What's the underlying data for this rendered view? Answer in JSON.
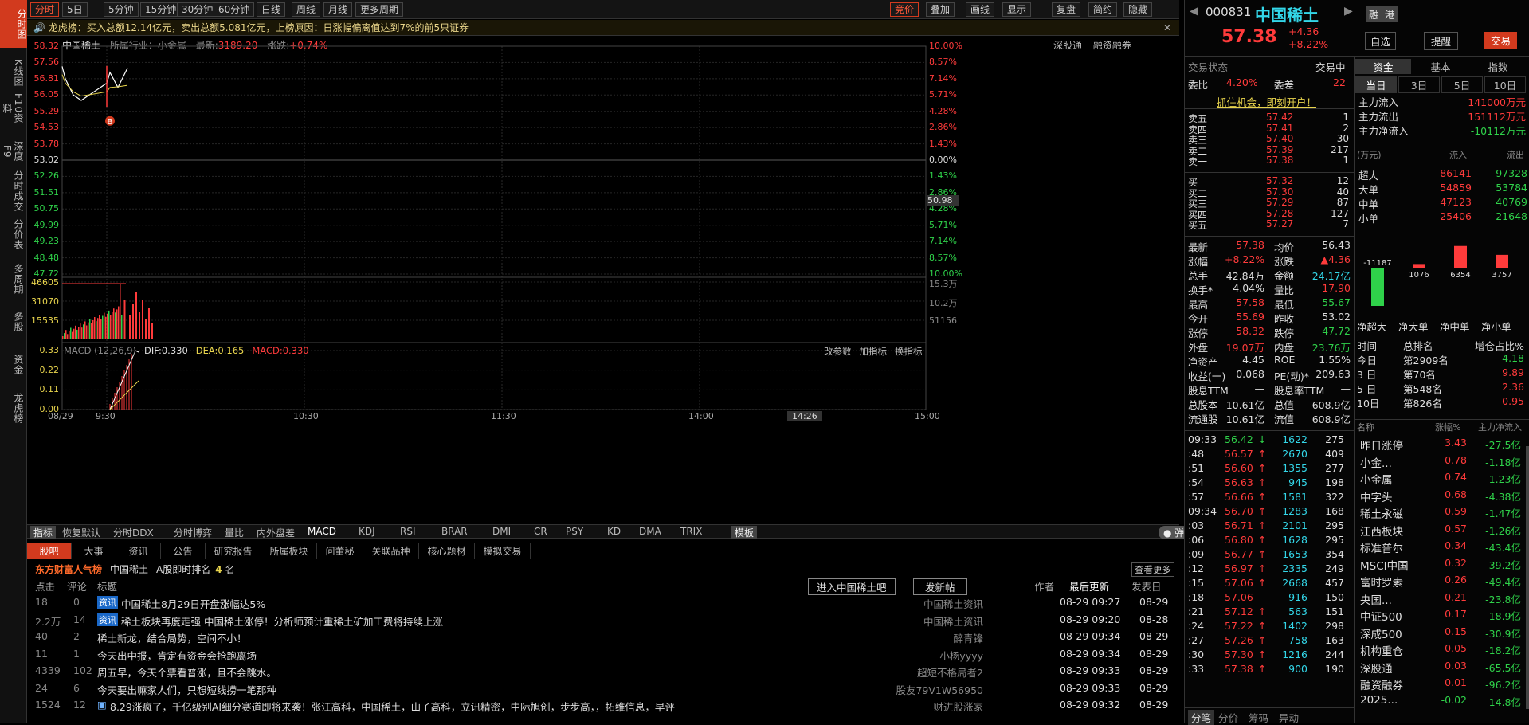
{
  "left_tabs": [
    "分时图",
    "K线图",
    "F10资料",
    "深度F9",
    "分时成交",
    "分价表",
    "多周期",
    "多股",
    "资金",
    "龙虎榜"
  ],
  "toolbar": {
    "items": [
      "分时",
      "5日",
      "5分钟",
      "15分钟",
      "30分钟",
      "60分钟",
      "日线",
      "周线",
      "月线",
      "更多周期"
    ],
    "right_items": [
      "竞价",
      "叠加",
      "画线",
      "显示",
      "复盘",
      "简约",
      "隐藏"
    ]
  },
  "lhb": {
    "text": "龙虎榜：买入总额12.14亿元，卖出总额5.081亿元，上榜原因：日涨幅偏离值达到7%的前5只证券"
  },
  "chart_header": {
    "name": "中国稀土",
    "industry": "所属行业：小金属",
    "latest_label": "最新:",
    "latest": "3189.20",
    "chg_label": "涨跌:",
    "chg": "+0.74%",
    "btn1": "深股通",
    "btn2": "融资融券"
  },
  "price_axis_left": [
    "58.32",
    "57.56",
    "56.81",
    "56.05",
    "55.29",
    "54.53",
    "53.78",
    "53.02",
    "52.26",
    "51.51",
    "50.75",
    "49.99",
    "49.23",
    "48.48",
    "47.72"
  ],
  "price_axis_right": [
    "10.00%",
    "8.57%",
    "7.14%",
    "5.71%",
    "4.28%",
    "2.86%",
    "1.43%",
    "0.00%",
    "1.43%",
    "2.86%",
    "4.28%",
    "5.71%",
    "7.14%",
    "8.57%",
    "10.00%"
  ],
  "mid_marker": "50.98",
  "vol_axis_left": [
    "46605",
    "31070",
    "15535"
  ],
  "vol_axis_right": [
    "15.3万",
    "10.2万",
    "51156"
  ],
  "macd": {
    "label": "MACD (12,26,9)",
    "dif": "DIF:0.330",
    "dea": "DEA:0.165",
    "macd": "MACD:0.330",
    "btns": [
      "改参数",
      "加指标",
      "换指标"
    ],
    "axis": [
      "0.33",
      "0.22",
      "0.11",
      "0.00"
    ]
  },
  "time_axis": [
    "08/29",
    "9:30",
    "10:30",
    "11:30",
    "14:00",
    "15:00"
  ],
  "time_marker": "14:26",
  "chart_data": {
    "type": "line",
    "title": "中国稀土",
    "x": [
      "9:30",
      "9:31",
      "9:32",
      "9:33",
      "9:34",
      "9:35",
      "9:36",
      "9:37"
    ],
    "price": [
      57.38,
      56.8,
      56.05,
      55.8,
      56.6,
      57.1,
      56.4,
      57.3
    ],
    "avg": [
      57.0,
      56.6,
      56.2,
      56.0,
      56.2,
      56.4,
      56.43,
      56.5
    ],
    "ylim": [
      47.72,
      58.32
    ],
    "prev_close": 53.02
  },
  "ind_tabs": [
    "指标",
    "恢复默认",
    "分时DDX",
    "分时博弈",
    "量比",
    "内外盘差",
    "MACD",
    "KDJ",
    "RSI",
    "BRAR",
    "DMI",
    "CR",
    "PSY",
    "KD",
    "DMA",
    "TRIX",
    "模板"
  ],
  "news": {
    "tabs": [
      "股吧",
      "大事",
      "资讯",
      "公告",
      "研究报告",
      "所属板块",
      "问董秘",
      "关联品种",
      "核心题材",
      "模拟交易"
    ],
    "rank": {
      "brand": "东方财富人气榜",
      "stock": "中国稀土",
      "label": "A股即时排名",
      "num": "4",
      "unit": "名",
      "more": "查看更多"
    },
    "cols": [
      "点击",
      "评论",
      "标题",
      "作者",
      "最后更新",
      "发表日"
    ],
    "btn_enter": "进入中国稀土吧",
    "btn_post": "发新帖",
    "rows": [
      {
        "clicks": "18",
        "comments": "0",
        "tag": "资讯",
        "title": "中国稀土8月29日开盘涨幅达5%",
        "author": "中国稀土资讯",
        "updated": "08-29 09:27",
        "date": "08-29"
      },
      {
        "clicks": "2.2万",
        "comments": "14",
        "tag": "资讯",
        "title": "稀土板块再度走强 中国稀土涨停！分析师预计重稀土矿加工费将持续上涨",
        "author": "中国稀土资讯",
        "updated": "08-29 09:20",
        "date": "08-28"
      },
      {
        "clicks": "40",
        "comments": "2",
        "tag": "",
        "title": "稀土新龙，结合局势，空间不小！",
        "author": "醉青锋",
        "updated": "08-29 09:34",
        "date": "08-29"
      },
      {
        "clicks": "11",
        "comments": "1",
        "tag": "",
        "title": "今天出中报，肯定有资金会抢跑离场",
        "author": "小杨yyyy",
        "updated": "08-29 09:34",
        "date": "08-29"
      },
      {
        "clicks": "4339",
        "comments": "102",
        "tag": "",
        "title": "周五早，今天个票看普涨，且不会跳水。",
        "author": "超短不格局者2",
        "updated": "08-29 09:33",
        "date": "08-29"
      },
      {
        "clicks": "24",
        "comments": "6",
        "tag": "",
        "title": "今天要出嘛家人们，只想短线捞一笔那种",
        "author": "股友79V1W56950",
        "updated": "08-29 09:33",
        "date": "08-29"
      },
      {
        "clicks": "1524",
        "comments": "12",
        "tag": "",
        "title": "8.29涨疯了，千亿级别AI细分赛道即将来袭！张江高科，中国稀土，山子高科，立讯精密，中际旭创，步步高，，拓维信息，早评",
        "author": "财进股涨家",
        "updated": "08-29 09:32",
        "date": "08-29"
      }
    ]
  },
  "quote": {
    "code": "000831",
    "name": "中国稀土",
    "price": "57.38",
    "chg": "+4.36",
    "pct": "+8.22%",
    "b1": "融",
    "b2": "港",
    "sel": "自选",
    "remind": "提醒",
    "trade": "交易",
    "status_label": "交易状态",
    "status": "交易中",
    "wb_label": "委比",
    "wb": "4.20%",
    "wc_label": "委差",
    "wc": "22",
    "promo": "抓住机会，即刻开户！",
    "sell": [
      [
        "卖五",
        "57.42",
        "1"
      ],
      [
        "卖四",
        "57.41",
        "2"
      ],
      [
        "卖三",
        "57.40",
        "30"
      ],
      [
        "卖二",
        "57.39",
        "217"
      ],
      [
        "卖一",
        "57.38",
        "1"
      ]
    ],
    "buy": [
      [
        "买一",
        "57.32",
        "12"
      ],
      [
        "买二",
        "57.30",
        "40"
      ],
      [
        "买三",
        "57.29",
        "87"
      ],
      [
        "买四",
        "57.28",
        "127"
      ],
      [
        "买五",
        "57.27",
        "7"
      ]
    ],
    "stats": [
      [
        "最新",
        "57.38",
        "均价",
        "56.43"
      ],
      [
        "涨幅",
        "+8.22%",
        "涨跌",
        "▲4.36"
      ],
      [
        "总手",
        "42.84万",
        "金额",
        "24.17亿"
      ],
      [
        "换手*",
        "4.04%",
        "量比",
        "17.90"
      ],
      [
        "最高",
        "57.58",
        "最低",
        "55.67"
      ],
      [
        "今开",
        "55.69",
        "昨收",
        "53.02"
      ],
      [
        "涨停",
        "58.32",
        "跌停",
        "47.72"
      ],
      [
        "外盘",
        "19.07万",
        "内盘",
        "23.76万"
      ],
      [
        "净资产",
        "4.45",
        "ROE",
        "1.55%"
      ],
      [
        "收益(一)",
        "0.068",
        "PE(动)*",
        "209.63"
      ],
      [
        "股息TTM",
        "—",
        "股息率TTM",
        "—"
      ],
      [
        "总股本",
        "10.61亿",
        "总值",
        "608.9亿"
      ],
      [
        "流通股",
        "10.61亿",
        "流值",
        "608.9亿"
      ]
    ]
  },
  "ticks": [
    {
      "t": "09:33",
      "p": "56.42",
      "v": "1622",
      "n": "275",
      "d": "down"
    },
    {
      "t": ":48",
      "p": "56.57",
      "v": "2670",
      "n": "409",
      "d": "up"
    },
    {
      "t": ":51",
      "p": "56.60",
      "v": "1355",
      "n": "277",
      "d": "up"
    },
    {
      "t": ":54",
      "p": "56.63",
      "v": "945",
      "n": "198",
      "d": "up"
    },
    {
      "t": ":57",
      "p": "56.66",
      "v": "1581",
      "n": "322",
      "d": "up"
    },
    {
      "t": "09:34",
      "p": "56.70",
      "v": "1283",
      "n": "168",
      "d": "up"
    },
    {
      "t": ":03",
      "p": "56.71",
      "v": "2101",
      "n": "295",
      "d": "up"
    },
    {
      "t": ":06",
      "p": "56.80",
      "v": "1628",
      "n": "295",
      "d": "up"
    },
    {
      "t": ":09",
      "p": "56.77",
      "v": "1653",
      "n": "354",
      "d": "up"
    },
    {
      "t": ":12",
      "p": "56.97",
      "v": "2335",
      "n": "249",
      "d": "up"
    },
    {
      "t": ":15",
      "p": "57.06",
      "v": "2668",
      "n": "457",
      "d": "up"
    },
    {
      "t": ":18",
      "p": "57.06",
      "v": "916",
      "n": "150",
      "d": ""
    },
    {
      "t": ":21",
      "p": "57.12",
      "v": "563",
      "n": "151",
      "d": "up"
    },
    {
      "t": ":24",
      "p": "57.22",
      "v": "1402",
      "n": "298",
      "d": "up"
    },
    {
      "t": ":27",
      "p": "57.26",
      "v": "758",
      "n": "163",
      "d": "up"
    },
    {
      "t": ":30",
      "p": "57.30",
      "v": "1216",
      "n": "244",
      "d": "up"
    },
    {
      "t": ":33",
      "p": "57.38",
      "v": "900",
      "n": "190",
      "d": "up"
    }
  ],
  "bottom_tabs": [
    "分笔",
    "分价",
    "筹码",
    "异动"
  ],
  "fund": {
    "tabs": [
      "资金",
      "基本",
      "指数"
    ],
    "sub": [
      "当日",
      "3日",
      "5日",
      "10日"
    ],
    "main": [
      [
        "主力流入",
        "141000万元"
      ],
      [
        "主力流出",
        "151112万元"
      ],
      [
        "主力净流入",
        "-10112万元"
      ]
    ],
    "unit": "(万元)",
    "in": "流入",
    "out": "流出",
    "rows": [
      [
        "超大",
        "86141",
        "97328"
      ],
      [
        "大单",
        "54859",
        "53784"
      ],
      [
        "中单",
        "47123",
        "40769"
      ],
      [
        "小单",
        "25406",
        "21648"
      ]
    ],
    "bars": [
      {
        "label": "净超大",
        "value": -11187
      },
      {
        "label": "净大单",
        "value": 1076
      },
      {
        "label": "净中单",
        "value": 6354
      },
      {
        "label": "净小单",
        "value": 3757
      }
    ],
    "rank_cols": [
      "时间",
      "总排名",
      "增仓占比%"
    ],
    "rank": [
      [
        "今日",
        "第2909名",
        "-4.18"
      ],
      [
        "3 日",
        "第70名",
        "9.89"
      ],
      [
        "5 日",
        "第548名",
        "2.36"
      ],
      [
        "10日",
        "第826名",
        "0.95"
      ]
    ],
    "sect_cols": [
      "名称",
      "涨幅%",
      "主力净流入"
    ],
    "sectors": [
      [
        "昨日涨停",
        "3.43",
        "-27.5亿"
      ],
      [
        "小金...",
        "0.78",
        "-1.18亿"
      ],
      [
        "小金属",
        "0.74",
        "-1.23亿"
      ],
      [
        "中字头",
        "0.68",
        "-4.38亿"
      ],
      [
        "稀土永磁",
        "0.59",
        "-1.47亿"
      ],
      [
        "江西板块",
        "0.57",
        "-1.26亿"
      ],
      [
        "标准普尔",
        "0.34",
        "-43.4亿"
      ],
      [
        "MSCI中国",
        "0.32",
        "-39.2亿"
      ],
      [
        "富时罗素",
        "0.26",
        "-49.4亿"
      ],
      [
        "央国...",
        "0.21",
        "-23.8亿"
      ],
      [
        "中证500",
        "0.17",
        "-18.9亿"
      ],
      [
        "深成500",
        "0.15",
        "-30.9亿"
      ],
      [
        "机构重仓",
        "0.05",
        "-18.2亿"
      ],
      [
        "深股通",
        "0.03",
        "-65.5亿"
      ],
      [
        "融资融券",
        "0.01",
        "-96.2亿"
      ],
      [
        "2025...",
        "-0.02",
        "-14.8亿"
      ]
    ]
  }
}
